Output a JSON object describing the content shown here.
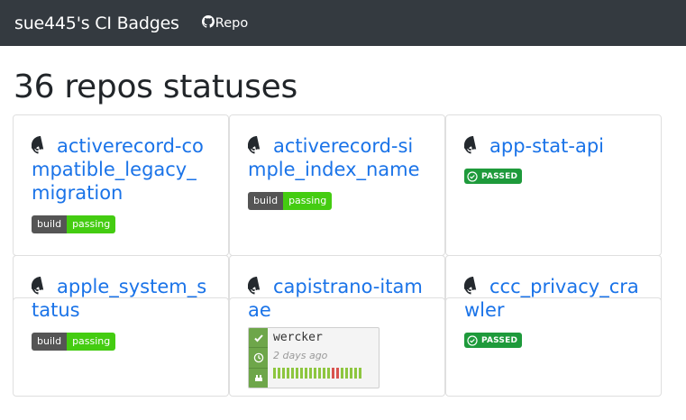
{
  "navbar": {
    "brand": "sue445's CI Badges",
    "repo_label": "Repo"
  },
  "heading": "36 repos statuses",
  "cards": [
    {
      "title": "activerecord-compatible_legacy_migration",
      "badge": {
        "type": "shield",
        "left": "build",
        "right": "passing"
      }
    },
    {
      "title": "activerecord-simple_index_name",
      "badge": {
        "type": "shield",
        "left": "build",
        "right": "passing"
      }
    },
    {
      "title": "app-stat-api",
      "badge": {
        "type": "passed",
        "label": "PASSED"
      }
    },
    {
      "title": "apple_system_status",
      "badge": {
        "type": "shield",
        "left": "build",
        "right": "passing"
      }
    },
    {
      "title": "capistrano-itamae",
      "badge": {
        "type": "wercker",
        "name": "wercker",
        "ago": "2 days ago"
      }
    },
    {
      "title": "ccc_privacy_crawler",
      "badge": {
        "type": "passed",
        "label": "PASSED"
      }
    }
  ],
  "colors": {
    "navbar_bg": "#343a40",
    "link": "#1a73e8",
    "passing": "#44cc11",
    "passed": "#1e9a3b"
  }
}
